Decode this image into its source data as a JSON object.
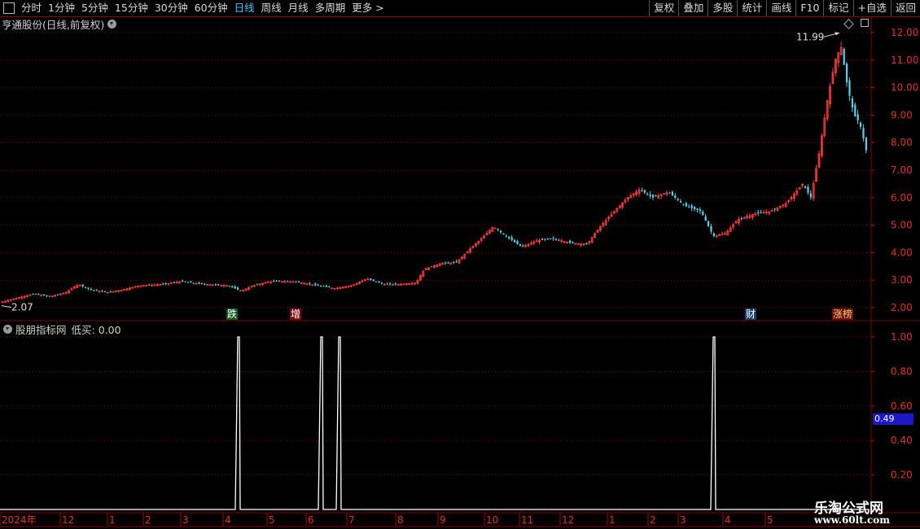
{
  "toolbar": {
    "left_items": [
      "分时",
      "1分钟",
      "5分钟",
      "15分钟",
      "30分钟",
      "60分钟",
      "日线",
      "周线",
      "月线",
      "多周期",
      "更多 >"
    ],
    "active": "日线",
    "right_buttons": [
      "复权",
      "叠加",
      "多股",
      "统计",
      "画线",
      "F10",
      "标记",
      "+自选",
      "返回"
    ]
  },
  "main_panel": {
    "title": "亨通股份(日线,前复权)",
    "high_label": "11.99",
    "low_label": "2.07",
    "y_ticks": [
      "12.00",
      "11.00",
      "10.00",
      "9.00",
      "8.00",
      "7.00",
      "6.00",
      "5.00",
      "4.00",
      "3.00",
      "2.00"
    ],
    "event_tags": [
      {
        "text": "跌",
        "bg": "#0f5a1e",
        "color": "#ffffff"
      },
      {
        "text": "增",
        "bg": "#7a0d0d",
        "color": "#ffffff"
      },
      {
        "text": "财",
        "bg": "#1a3f6e",
        "color": "#ffffff"
      },
      {
        "text": "涨榜",
        "bg": "#6a1010",
        "color": "#ffcc66"
      }
    ]
  },
  "indicator_panel": {
    "name": "股朋指标网",
    "label": "低买: 0.00",
    "y_ticks": [
      "1.00",
      "0.80",
      "0.60",
      "0.40",
      "0.20"
    ],
    "current_value": "0.49"
  },
  "time_axis": [
    "2024年",
    "12",
    "1",
    "2",
    "3",
    "4",
    "5",
    "6",
    "7",
    "8",
    "9",
    "10",
    "11",
    "12",
    "1",
    "2",
    "3",
    "4",
    "5"
  ],
  "watermark": {
    "line1": "乐淘公式网",
    "line2": "www.60lt.com"
  },
  "chart_data": {
    "type": "line",
    "close_anchors": [
      [
        0,
        2.2
      ],
      [
        20,
        2.35
      ],
      [
        40,
        2.5
      ],
      [
        60,
        2.4
      ],
      [
        80,
        2.55
      ],
      [
        95,
        2.85
      ],
      [
        110,
        2.65
      ],
      [
        130,
        2.55
      ],
      [
        150,
        2.65
      ],
      [
        170,
        2.8
      ],
      [
        200,
        2.85
      ],
      [
        220,
        2.95
      ],
      [
        250,
        2.85
      ],
      [
        280,
        2.8
      ],
      [
        295,
        2.6
      ],
      [
        310,
        2.8
      ],
      [
        330,
        2.95
      ],
      [
        360,
        2.95
      ],
      [
        390,
        2.8
      ],
      [
        410,
        2.7
      ],
      [
        430,
        2.8
      ],
      [
        450,
        3.05
      ],
      [
        470,
        2.85
      ],
      [
        490,
        2.85
      ],
      [
        510,
        2.9
      ],
      [
        520,
        3.4
      ],
      [
        540,
        3.6
      ],
      [
        560,
        3.65
      ],
      [
        575,
        4.1
      ],
      [
        590,
        4.5
      ],
      [
        605,
        4.95
      ],
      [
        620,
        4.6
      ],
      [
        640,
        4.2
      ],
      [
        660,
        4.45
      ],
      [
        680,
        4.5
      ],
      [
        700,
        4.35
      ],
      [
        720,
        4.3
      ],
      [
        735,
        4.9
      ],
      [
        750,
        5.4
      ],
      [
        770,
        6.0
      ],
      [
        785,
        6.3
      ],
      [
        800,
        6.0
      ],
      [
        820,
        6.2
      ],
      [
        840,
        5.7
      ],
      [
        860,
        5.5
      ],
      [
        875,
        4.6
      ],
      [
        890,
        4.7
      ],
      [
        905,
        5.2
      ],
      [
        925,
        5.4
      ],
      [
        945,
        5.5
      ],
      [
        965,
        5.8
      ],
      [
        985,
        6.5
      ],
      [
        995,
        6.0
      ],
      [
        1005,
        7.6
      ],
      [
        1015,
        9.5
      ],
      [
        1025,
        11.0
      ],
      [
        1032,
        11.5
      ],
      [
        1040,
        10.0
      ],
      [
        1048,
        9.0
      ],
      [
        1055,
        8.7
      ],
      [
        1063,
        7.7
      ]
    ],
    "high": 11.99,
    "low": 2.07,
    "ylim_main": [
      2.0,
      12.0
    ],
    "indicator_name": "低买",
    "indicator_spikes_x": [
      292,
      394,
      416,
      876
    ],
    "ylim_indicator": [
      0.0,
      1.0
    ]
  }
}
